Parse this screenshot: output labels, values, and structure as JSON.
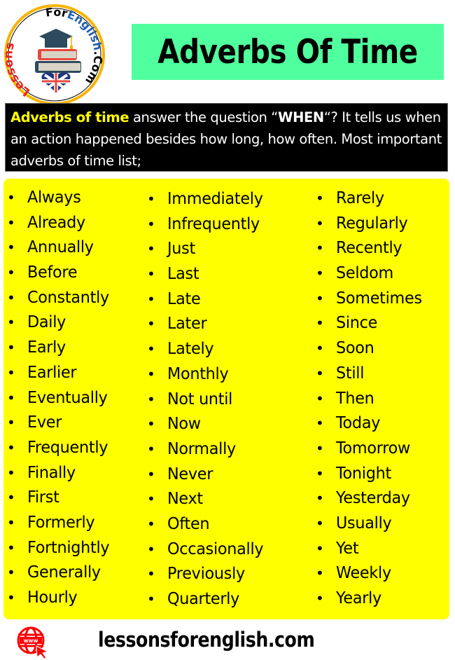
{
  "logo": {
    "text_left": "Lessons",
    "text_mid": "For",
    "text_right": "English",
    "text_suffix": ".Com",
    "icon": "books-graduation-cap-uk-heart-logo"
  },
  "title": "Adverbs Of Time",
  "intro": {
    "highlight": "Adverbs of time",
    "part1": " answer the question “",
    "bold": "WHEN",
    "part2": "“? It tells us when an action happened besides how long, how often. Most important adverbs of time list;"
  },
  "colors": {
    "title_bg": "#50ff9d",
    "intro_bg": "#000000",
    "intro_highlight": "#ffff00",
    "list_bg": "#ffff00",
    "footer_icon": "#ff0000"
  },
  "bullet": "•",
  "columns": [
    [
      "Always",
      "Already",
      "Annually",
      "Before",
      "Constantly",
      "Daily",
      "Early",
      "Earlier",
      "Eventually",
      "Ever",
      "Frequently",
      "Finally",
      "First",
      "Formerly",
      "Fortnightly",
      "Generally",
      "Hourly"
    ],
    [
      "Immediately",
      "Infrequently",
      "Just",
      "Last",
      "Late",
      "Later",
      "Lately",
      "Monthly",
      "Not until",
      "Now",
      "Normally",
      "Never",
      "Next",
      "Often",
      "Occasionally",
      "Previously",
      "Quarterly"
    ],
    [
      "Rarely",
      "Regularly",
      "Recently",
      "Seldom",
      "Sometimes",
      "Since",
      "Soon",
      "Still",
      "Then",
      "Today",
      "Tomorrow",
      "Tonight",
      "Yesterday",
      "Usually",
      "Yet",
      "Weekly",
      "Yearly"
    ]
  ],
  "footer": {
    "icon": "www-globe-cursor-icon",
    "website": "lessonsforenglish.com"
  }
}
